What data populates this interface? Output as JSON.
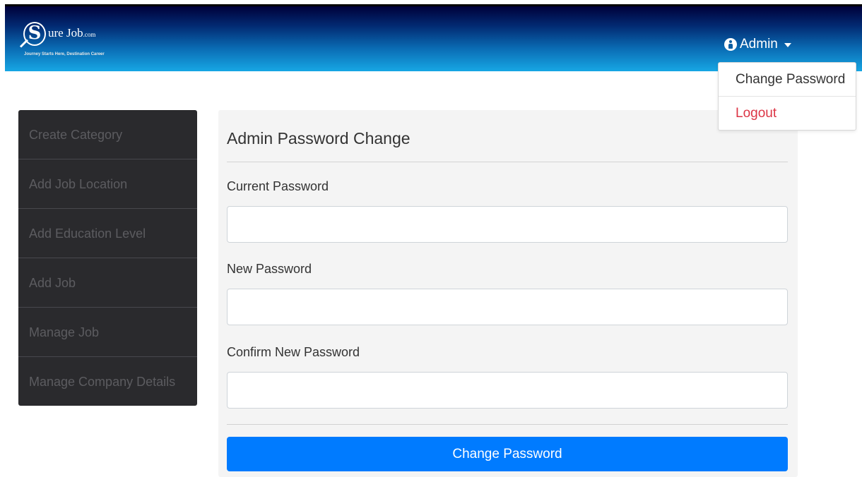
{
  "logo": {
    "letter": "S",
    "name": "ure Job",
    "suffix": ".com",
    "tagline": "Journey Starts Here, Destination Career"
  },
  "header": {
    "user_label": "Admin",
    "user_icon": "user-circle-icon",
    "caret_icon": "caret-down-icon"
  },
  "dropdown": {
    "items": [
      {
        "label": "Change Password"
      },
      {
        "label": "Logout"
      }
    ]
  },
  "sidebar": {
    "items": [
      {
        "label": "Create Category"
      },
      {
        "label": "Add Job Location"
      },
      {
        "label": "Add Education Level"
      },
      {
        "label": "Add Job"
      },
      {
        "label": "Manage Job"
      },
      {
        "label": "Manage Company Details"
      }
    ]
  },
  "form": {
    "title": "Admin Password Change",
    "fields": [
      {
        "label": "Current Password",
        "value": "",
        "placeholder": ""
      },
      {
        "label": "New Password",
        "value": "",
        "placeholder": ""
      },
      {
        "label": "Confirm New Password",
        "value": "",
        "placeholder": ""
      }
    ],
    "submit_label": "Change Password"
  },
  "colors": {
    "header_top": "#00003a",
    "header_bottom": "#17a7e4",
    "sidebar_bg": "#2a2a2d",
    "primary": "#007bff",
    "danger": "#dc3545"
  }
}
